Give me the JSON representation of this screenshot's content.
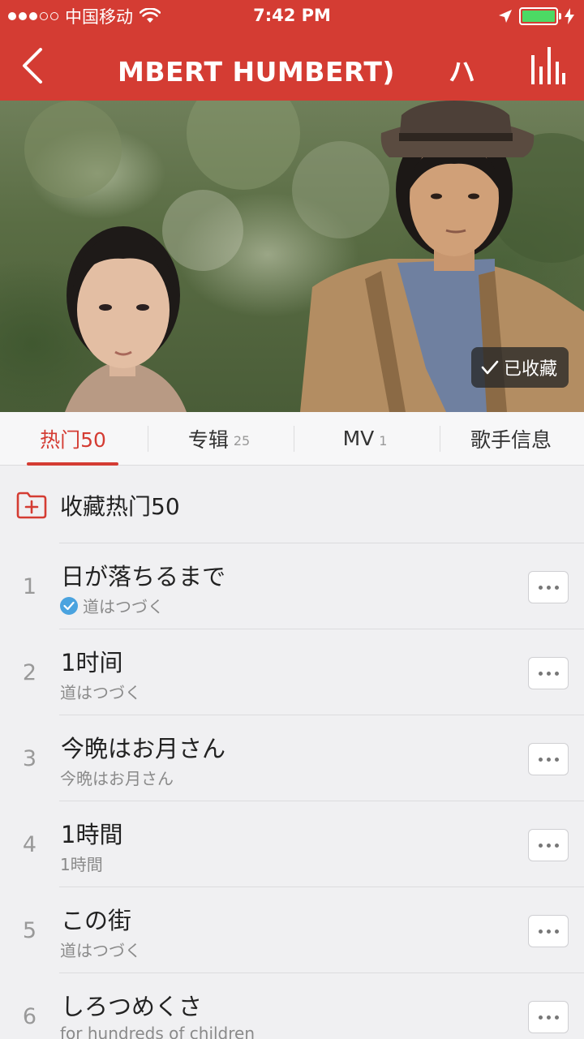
{
  "status_bar": {
    "carrier": "中国移动",
    "time": "7:42 PM",
    "signal_strength": 3,
    "battery_color": "#4cd964"
  },
  "nav": {
    "title_part1": "MBERT HUMBERT)",
    "title_part2": "ハン",
    "back_icon": "chevron-left-icon",
    "equalizer_icon": "equalizer-icon",
    "bar_color": "#d43c33"
  },
  "hero": {
    "favorite_label": "已收藏",
    "favorite_icon": "checkmark-icon"
  },
  "tabs": [
    {
      "label": "热门50",
      "count": "",
      "active": true
    },
    {
      "label": "专辑",
      "count": "25",
      "active": false
    },
    {
      "label": "MV",
      "count": "1",
      "active": false
    },
    {
      "label": "歌手信息",
      "count": "",
      "active": false
    }
  ],
  "collect": {
    "label": "收藏热门50",
    "icon": "folder-add-icon"
  },
  "songs": [
    {
      "num": "1",
      "title": "日が落ちるまで",
      "album": "道はつづく",
      "downloaded": true
    },
    {
      "num": "2",
      "title": "1时间",
      "album": "道はつづく",
      "downloaded": false
    },
    {
      "num": "3",
      "title": "今晩はお月さん",
      "album": "今晩はお月さん",
      "downloaded": false
    },
    {
      "num": "4",
      "title": "1時間",
      "album": "1時間",
      "downloaded": false
    },
    {
      "num": "5",
      "title": "この街",
      "album": "道はつづく",
      "downloaded": false
    },
    {
      "num": "6",
      "title": "しろつめくさ",
      "album": "for hundreds of children",
      "downloaded": false
    }
  ]
}
